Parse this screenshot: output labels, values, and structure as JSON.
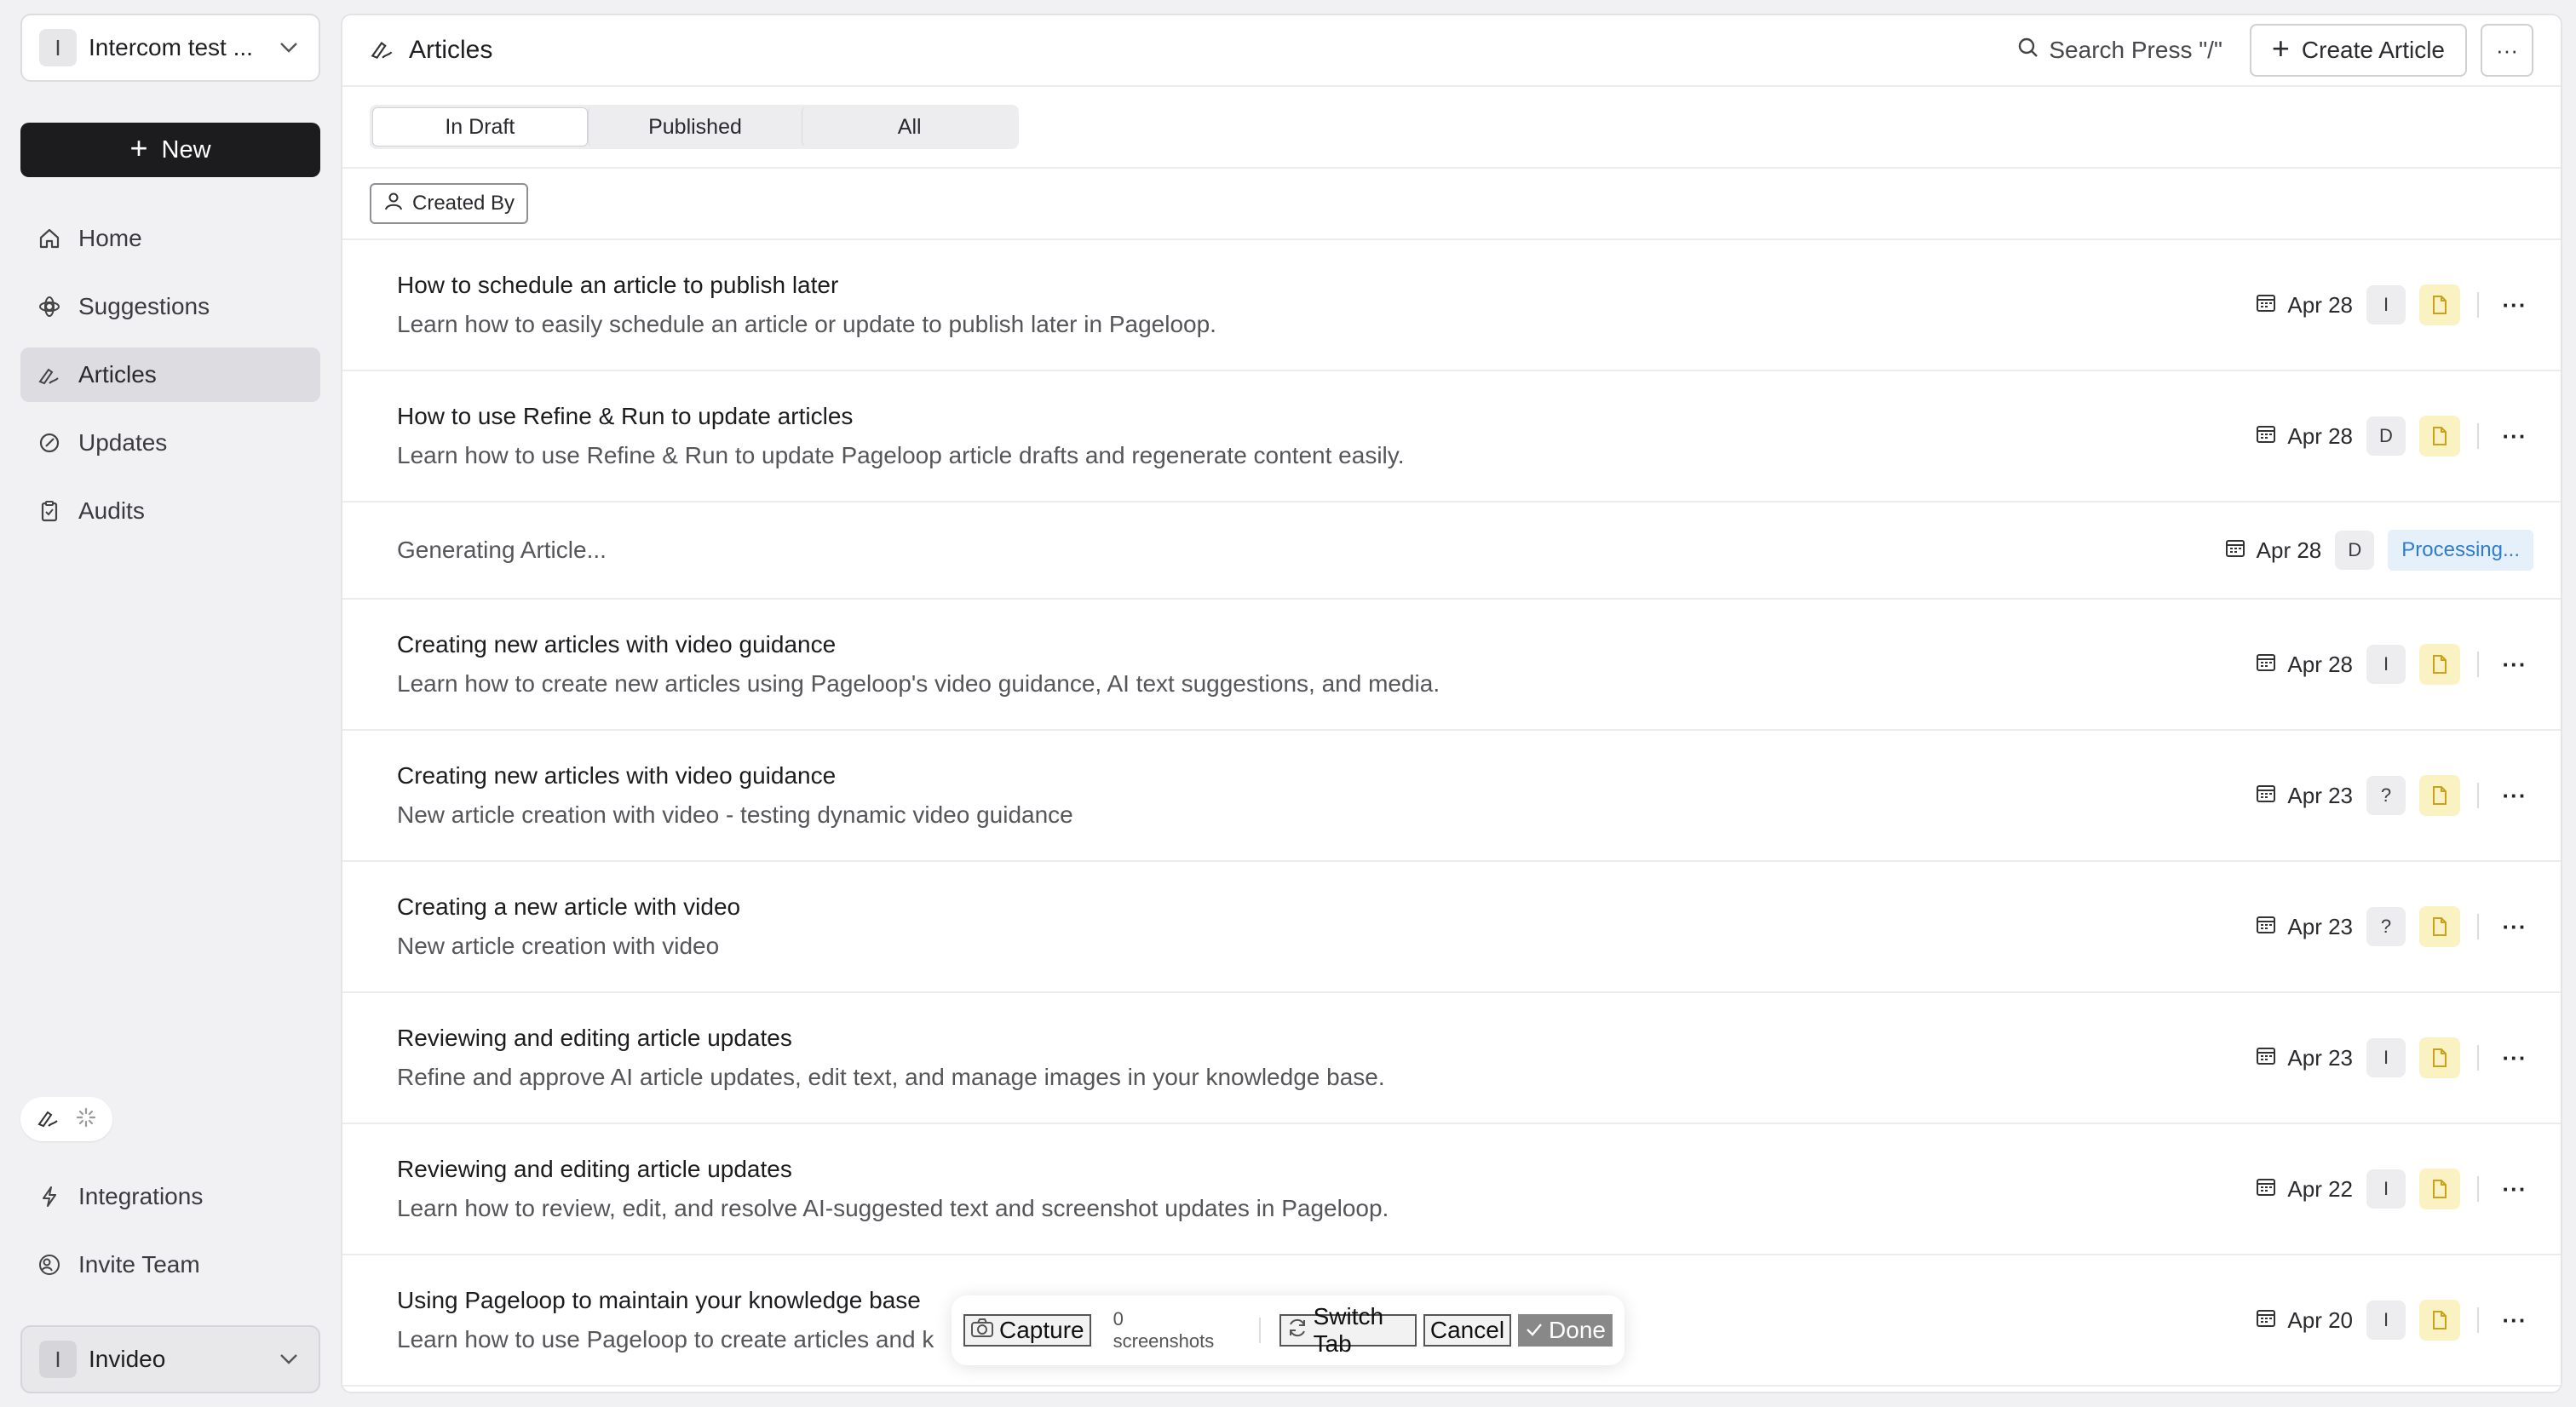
{
  "sidebar": {
    "workspace": {
      "initial": "I",
      "name": "Intercom test ..."
    },
    "new_label": "New",
    "nav": [
      {
        "label": "Home",
        "icon": "home-icon"
      },
      {
        "label": "Suggestions",
        "icon": "suggestions-icon"
      },
      {
        "label": "Articles",
        "icon": "articles-icon",
        "active": true
      },
      {
        "label": "Updates",
        "icon": "updates-icon"
      },
      {
        "label": "Audits",
        "icon": "audits-icon"
      }
    ],
    "bottom_nav": [
      {
        "label": "Integrations",
        "icon": "lightning-icon"
      },
      {
        "label": "Invite Team",
        "icon": "invite-team-icon"
      }
    ],
    "team": {
      "initial": "I",
      "name": "Invideo"
    }
  },
  "header": {
    "title": "Articles",
    "search_label": "Search Press \"/\"",
    "create_label": "Create Article",
    "more_label": "···"
  },
  "tabs": [
    {
      "label": "In Draft",
      "active": true
    },
    {
      "label": "Published",
      "active": false
    },
    {
      "label": "All",
      "active": false
    }
  ],
  "filter": {
    "label": "Created By"
  },
  "articles": [
    {
      "title": "How to schedule an article to publish later",
      "description": "Learn how to easily schedule an article or update to publish later in Pageloop.",
      "date": "Apr 28",
      "author": "I"
    },
    {
      "title": "How to use Refine & Run to update articles",
      "description": "Learn how to use Refine & Run to update Pageloop article drafts and regenerate content easily.",
      "date": "Apr 28",
      "author": "D"
    },
    {
      "title": "Generating Article...",
      "description": "",
      "date": "Apr 28",
      "author": "D",
      "status": "Processing..."
    },
    {
      "title": "Creating new articles with video guidance",
      "description": "Learn how to create new articles using Pageloop's video guidance, AI text suggestions, and media.",
      "date": "Apr 28",
      "author": "I"
    },
    {
      "title": "Creating new articles with video guidance",
      "description": "New article creation with video - testing dynamic video guidance",
      "date": "Apr 23",
      "author": "?"
    },
    {
      "title": "Creating a new article with video",
      "description": "New article creation with video",
      "date": "Apr 23",
      "author": "?"
    },
    {
      "title": "Reviewing and editing article updates",
      "description": "Refine and approve AI article updates, edit text, and manage images in your knowledge base.",
      "date": "Apr 23",
      "author": "I"
    },
    {
      "title": "Reviewing and editing article updates",
      "description": "Learn how to review, edit, and resolve AI-suggested text and screenshot updates in Pageloop.",
      "date": "Apr 22",
      "author": "I"
    },
    {
      "title": "Using Pageloop to maintain your knowledge base",
      "description": "Learn how to use Pageloop to create articles and k",
      "date": "Apr 20",
      "author": "I"
    }
  ],
  "capture_bar": {
    "capture_label": "Capture",
    "count_label": "0 screenshots",
    "switch_label": "Switch Tab",
    "cancel_label": "Cancel",
    "done_label": "Done"
  },
  "colors": {
    "sidebar_bg": "#f1f1f3",
    "new_button_bg": "#1c1c1e",
    "processing_text": "#2e7bd0",
    "processing_bg": "#e5f0fb",
    "doc_badge_bg": "#fbf2c4"
  }
}
